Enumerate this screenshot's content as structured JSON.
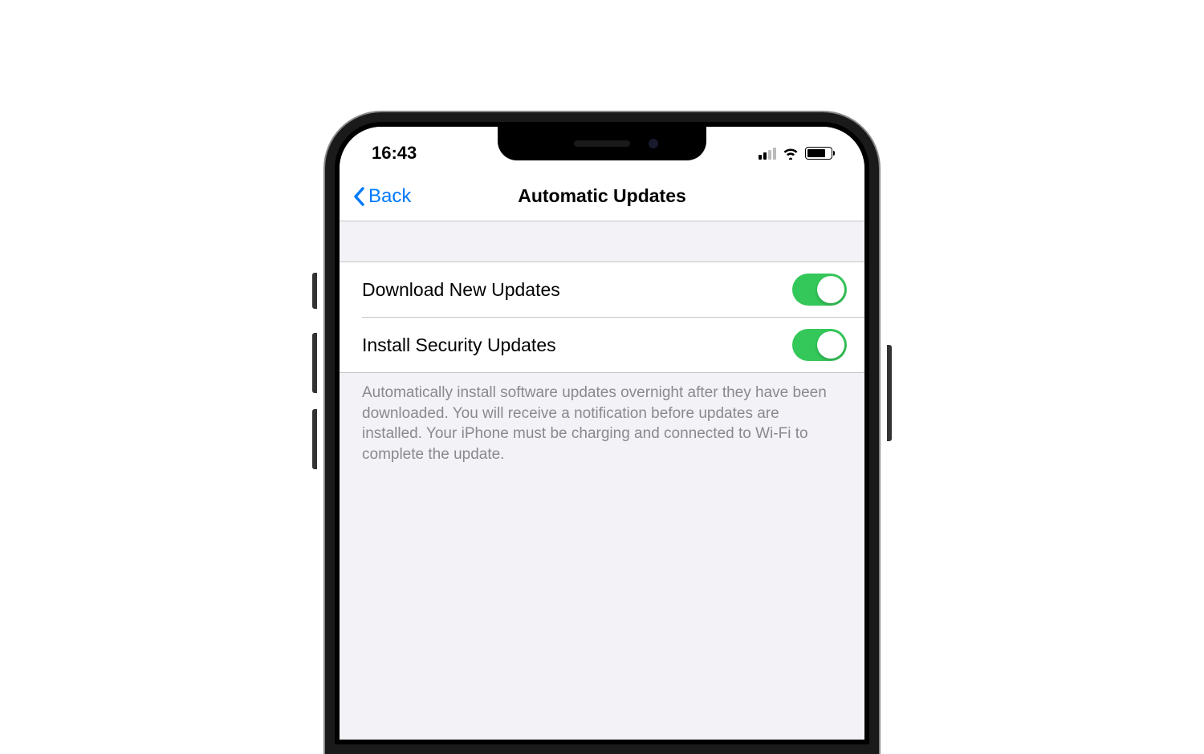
{
  "statusBar": {
    "time": "16:43"
  },
  "navBar": {
    "backLabel": "Back",
    "title": "Automatic Updates"
  },
  "settings": {
    "rows": [
      {
        "label": "Download New Updates",
        "enabled": true
      },
      {
        "label": "Install Security Updates",
        "enabled": true
      }
    ],
    "footerText": "Automatically install software updates overnight after they have been downloaded. You will receive a notification before updates are installed. Your iPhone must be charging and connected to Wi-Fi to complete the update."
  }
}
